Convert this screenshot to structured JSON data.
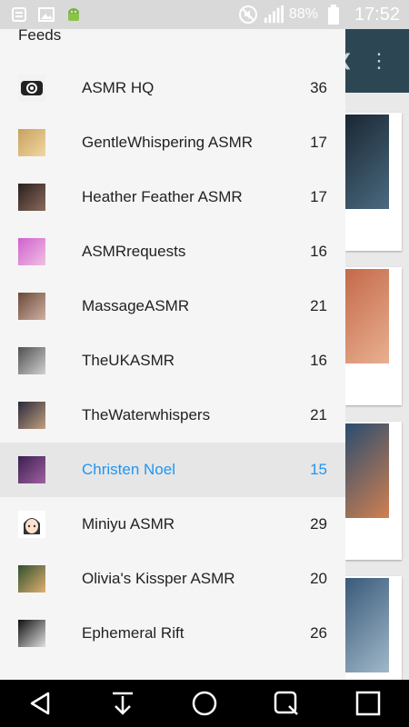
{
  "status_bar": {
    "icons_left": [
      "notes-icon",
      "image-icon",
      "android-icon"
    ],
    "icons_right": [
      "mute-icon",
      "signal-icon",
      "battery-icon"
    ],
    "battery": "88%",
    "time": "17:52"
  },
  "drawer": {
    "title": "Feeds",
    "items": [
      {
        "name": "ASMR HQ",
        "count": "36"
      },
      {
        "name": "GentleWhispering ASMR",
        "count": "17"
      },
      {
        "name": "Heather Feather ASMR",
        "count": "17"
      },
      {
        "name": "ASMRrequests",
        "count": "16"
      },
      {
        "name": "MassageASMR",
        "count": "21"
      },
      {
        "name": "TheUKASMR",
        "count": "16"
      },
      {
        "name": "TheWaterwhispers",
        "count": "21"
      },
      {
        "name": "Christen Noel",
        "count": "15",
        "selected": true
      },
      {
        "name": "Miniyu ASMR",
        "count": "29"
      },
      {
        "name": "Olivia's Kissper ASMR",
        "count": "20"
      },
      {
        "name": "Ephemeral Rift",
        "count": "26"
      }
    ]
  },
  "colors": {
    "accent": "#2196f3",
    "toolbar": "#2d4653",
    "drawer_bg": "#f5f5f5",
    "selected_bg": "#e6e6e6"
  },
  "nav_bar": {
    "buttons": [
      "back-icon",
      "download-icon",
      "home-icon",
      "search-icon",
      "recents-icon"
    ]
  }
}
